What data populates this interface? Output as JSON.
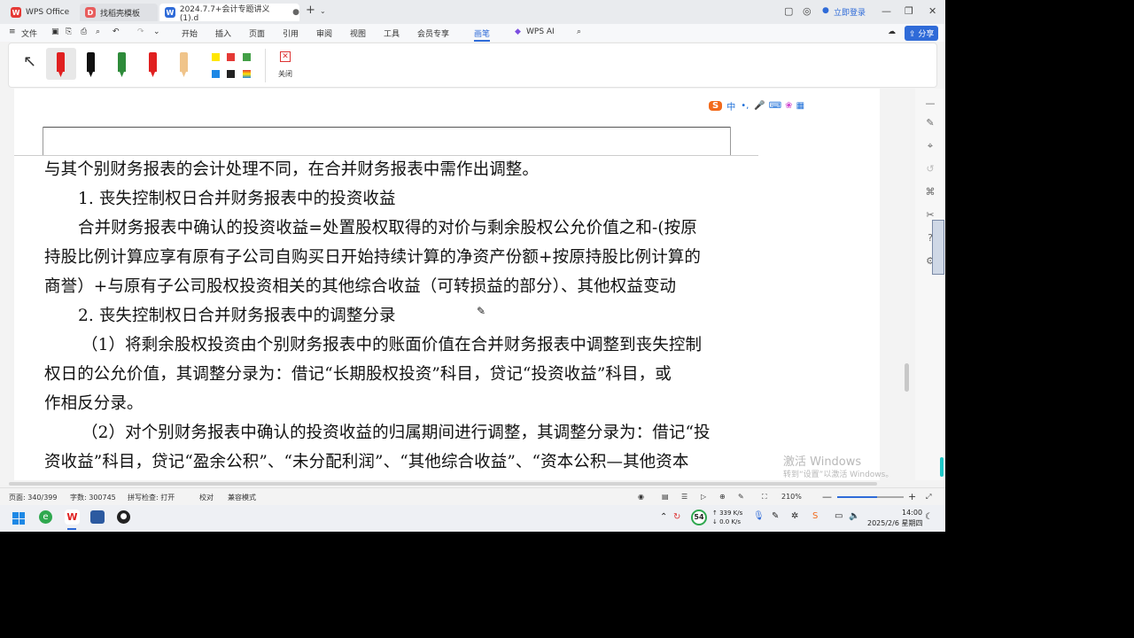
{
  "tabs": [
    {
      "label": "WPS Office",
      "icon": "W"
    },
    {
      "label": "找稻壳模板",
      "icon": "D"
    },
    {
      "label": "2024.7.7+会计专题讲义(1).d",
      "icon": "W"
    }
  ],
  "window": {
    "login": "立即登录"
  },
  "menu": {
    "file": "文件",
    "items": [
      "开始",
      "插入",
      "页面",
      "引用",
      "审阅",
      "视图",
      "工具",
      "会员专享",
      "画笔",
      "WPS AI"
    ],
    "share": "分享"
  },
  "ribbon": {
    "close": "关闭",
    "colors": [
      "#ffe600",
      "#e53935",
      "#43a047",
      "#1e88e5",
      "#222222"
    ]
  },
  "ime": {
    "lang": "中"
  },
  "doc": {
    "lines": [
      "与其个别财务报表的会计处理不同，在合并财务报表中需作出调整。",
      "1. 丧失控制权日合并财务报表中的投资收益",
      "合并财务报表中确认的投资收益=处置股权取得的对价与剩余股权公允价值之和-(按原",
      "持股比例计算应享有原有子公司自购买日开始持续计算的净资产份额+按原持股比例计算的",
      "商誉）+与原有子公司股权投资相关的其他综合收益（可转损益的部分）、其他权益变动",
      "2. 丧失控制权日合并财务报表中的调整分录",
      "（1）将剩余股权投资由个别财务报表中的账面价值在合并财务报表中调整到丧失控制",
      "权日的公允价值，其调整分录为：借记“长期股权投资”科目，贷记“投资收益”科目，或",
      "作相反分录。",
      "（2）对个别财务报表中确认的投资收益的归属期间进行调整，其调整分录为：借记“投",
      "资收益”科目，贷记“盈余公积”、“未分配利润”、“其他综合收益”、“资本公积—其他资本"
    ]
  },
  "watermark": {
    "title": "激活 Windows",
    "sub": "转到“设置”以激活 Windows。"
  },
  "status": {
    "page": "页面: 340/399",
    "words": "字数: 300745",
    "spell": "拼写检查: 打开",
    "proof": "校对",
    "compat": "兼容模式",
    "zoom": "210%",
    "zoom_level": 0.6
  },
  "taskbar": {
    "badge": "54",
    "net_up": "↑ 339 K/s",
    "net_down": "↓ 0.0 K/s",
    "time": "14:00",
    "date": "2025/2/6 星期四"
  }
}
